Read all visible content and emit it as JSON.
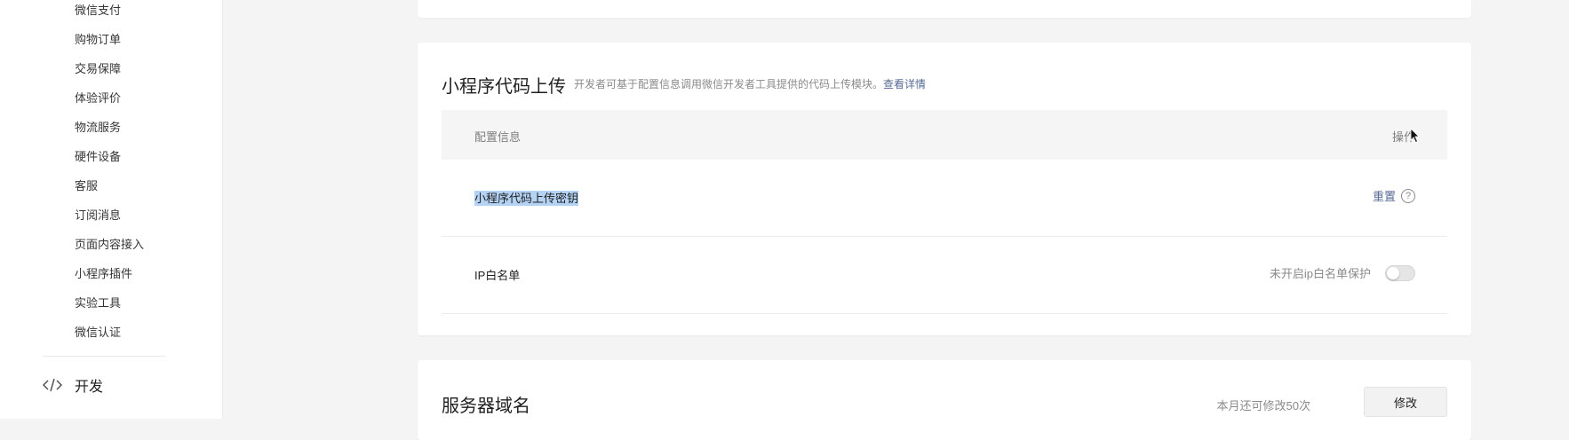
{
  "sidebar": {
    "items": [
      {
        "label": "微信支付"
      },
      {
        "label": "购物订单"
      },
      {
        "label": "交易保障"
      },
      {
        "label": "体验评价"
      },
      {
        "label": "物流服务"
      },
      {
        "label": "硬件设备"
      },
      {
        "label": "客服"
      },
      {
        "label": "订阅消息"
      },
      {
        "label": "页面内容接入"
      },
      {
        "label": "小程序插件"
      },
      {
        "label": "实验工具"
      },
      {
        "label": "微信认证"
      }
    ],
    "dev_label": "开发",
    "dev_icon": "code-icon"
  },
  "upload": {
    "title": "小程序代码上传",
    "desc": "开发者可基于配置信息调用微信开发者工具提供的代码上传模块。",
    "desc_link": "查看详情",
    "col_info": "配置信息",
    "col_op": "操作",
    "rows": [
      {
        "label": "小程序代码上传密钥",
        "action": "重置",
        "help": "?"
      },
      {
        "label": "IP白名单",
        "status": "未开启ip白名单保护",
        "toggle_on": false
      }
    ]
  },
  "domain": {
    "title": "服务器域名",
    "count_text": "本月还可修改50次",
    "modify_label": "修改"
  },
  "colors": {
    "link": "#576b95",
    "highlight": "#b4d2f4",
    "background": "#f4f4f5"
  }
}
